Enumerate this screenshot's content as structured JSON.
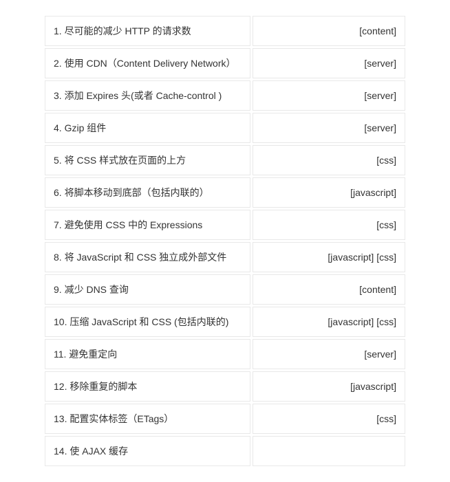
{
  "rows": [
    {
      "rule": "1. 尽可能的减少 HTTP 的请求数",
      "tags": "[content]"
    },
    {
      "rule": "2. 使用 CDN（Content Delivery Network）",
      "tags": "[server]"
    },
    {
      "rule": "3. 添加 Expires 头(或者 Cache-control )",
      "tags": "[server]"
    },
    {
      "rule": "4. Gzip 组件",
      "tags": "[server]"
    },
    {
      "rule": "5. 将 CSS 样式放在页面的上方",
      "tags": "[css]"
    },
    {
      "rule": "6. 将脚本移动到底部（包括内联的）",
      "tags": "[javascript]"
    },
    {
      "rule": "7. 避免使用 CSS 中的 Expressions",
      "tags": "[css]"
    },
    {
      "rule": "8. 将 JavaScript 和 CSS 独立成外部文件",
      "tags": "[javascript] [css]"
    },
    {
      "rule": "9. 减少 DNS 查询",
      "tags": "[content]"
    },
    {
      "rule": "10. 压缩 JavaScript 和 CSS (包括内联的)",
      "tags": "[javascript] [css]"
    },
    {
      "rule": "11. 避免重定向",
      "tags": "[server]"
    },
    {
      "rule": "12. 移除重复的脚本",
      "tags": "[javascript]"
    },
    {
      "rule": "13. 配置实体标签（ETags）",
      "tags": "[css]"
    },
    {
      "rule": "14. 使 AJAX 缓存",
      "tags": ""
    }
  ]
}
